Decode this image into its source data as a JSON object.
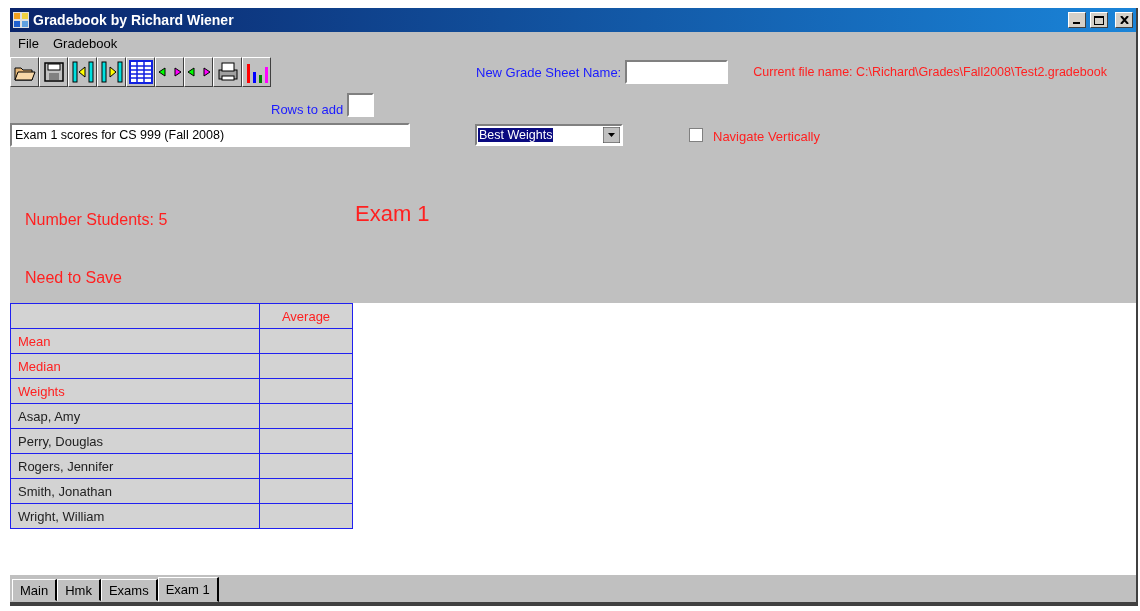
{
  "window": {
    "title": "Gradebook by Richard Wiener"
  },
  "menu": [
    "File",
    "Gradebook"
  ],
  "new_sheet": {
    "label": "New Grade Sheet Name:"
  },
  "current_file": "Current file name: C:\\Richard\\Grades\\Fall2008\\Test2.gradebook",
  "rows_to_add": {
    "label": "Rows to add"
  },
  "sheet_title": {
    "value": "Exam 1 scores for CS 999 (Fall 2008)"
  },
  "weights_dropdown": {
    "value": "Best Weights"
  },
  "navigate_vertically": {
    "label": "Navigate Vertically",
    "checked": false
  },
  "number_students": "Number Students: 5",
  "heading": "Exam 1",
  "save_status": "Need to Save",
  "table": {
    "columns": [
      "",
      "Average"
    ],
    "rows": [
      {
        "kind": "stat",
        "name": "Mean"
      },
      {
        "kind": "stat",
        "name": "Median"
      },
      {
        "kind": "stat",
        "name": "Weights"
      },
      {
        "kind": "student",
        "name": "Asap, Amy"
      },
      {
        "kind": "student",
        "name": "Perry, Douglas"
      },
      {
        "kind": "student",
        "name": "Rogers, Jennifer"
      },
      {
        "kind": "student",
        "name": "Smith, Jonathan"
      },
      {
        "kind": "student",
        "name": "Wright, William"
      }
    ]
  },
  "tabs": [
    {
      "label": "Main",
      "selected": false
    },
    {
      "label": "Hmk",
      "selected": false
    },
    {
      "label": "Exams",
      "selected": false
    },
    {
      "label": "Exam 1",
      "selected": true
    }
  ]
}
